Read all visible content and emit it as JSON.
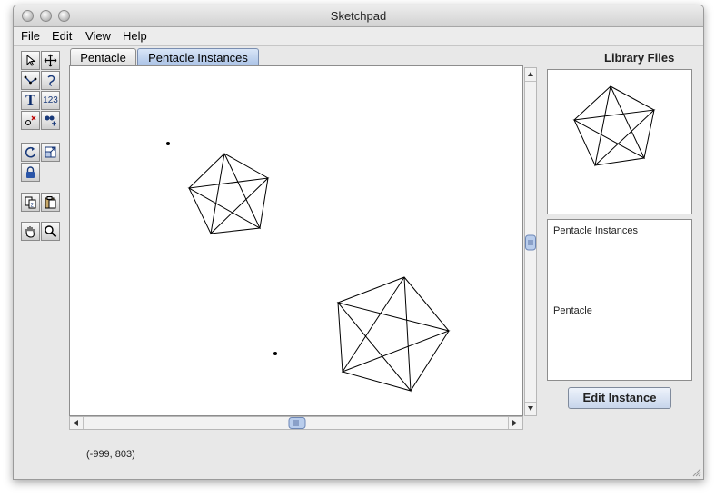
{
  "window": {
    "title": "Sketchpad"
  },
  "menu": {
    "items": [
      "File",
      "Edit",
      "View",
      "Help"
    ]
  },
  "tabs": [
    {
      "label": "Pentacle",
      "active": false
    },
    {
      "label": "Pentacle Instances",
      "active": true
    }
  ],
  "toolbar": {
    "tools": [
      "select-arrow-icon",
      "move-icon",
      "line-tool-icon",
      "lasso-icon",
      "text-tool-icon",
      "number-tool-icon",
      "point-tool-icon",
      "merge-icon",
      "rotate-icon",
      "scale-icon",
      "lock-icon",
      "copy-icon",
      "paste-icon",
      "hand-icon",
      "zoom-icon"
    ],
    "text_label": "T",
    "number_label": "123"
  },
  "status": {
    "coordinates": "(-999, 803)"
  },
  "library": {
    "title": "Library Files",
    "items": [
      "Pentacle Instances",
      "Pentacle"
    ],
    "edit_button": "Edit Instance"
  }
}
